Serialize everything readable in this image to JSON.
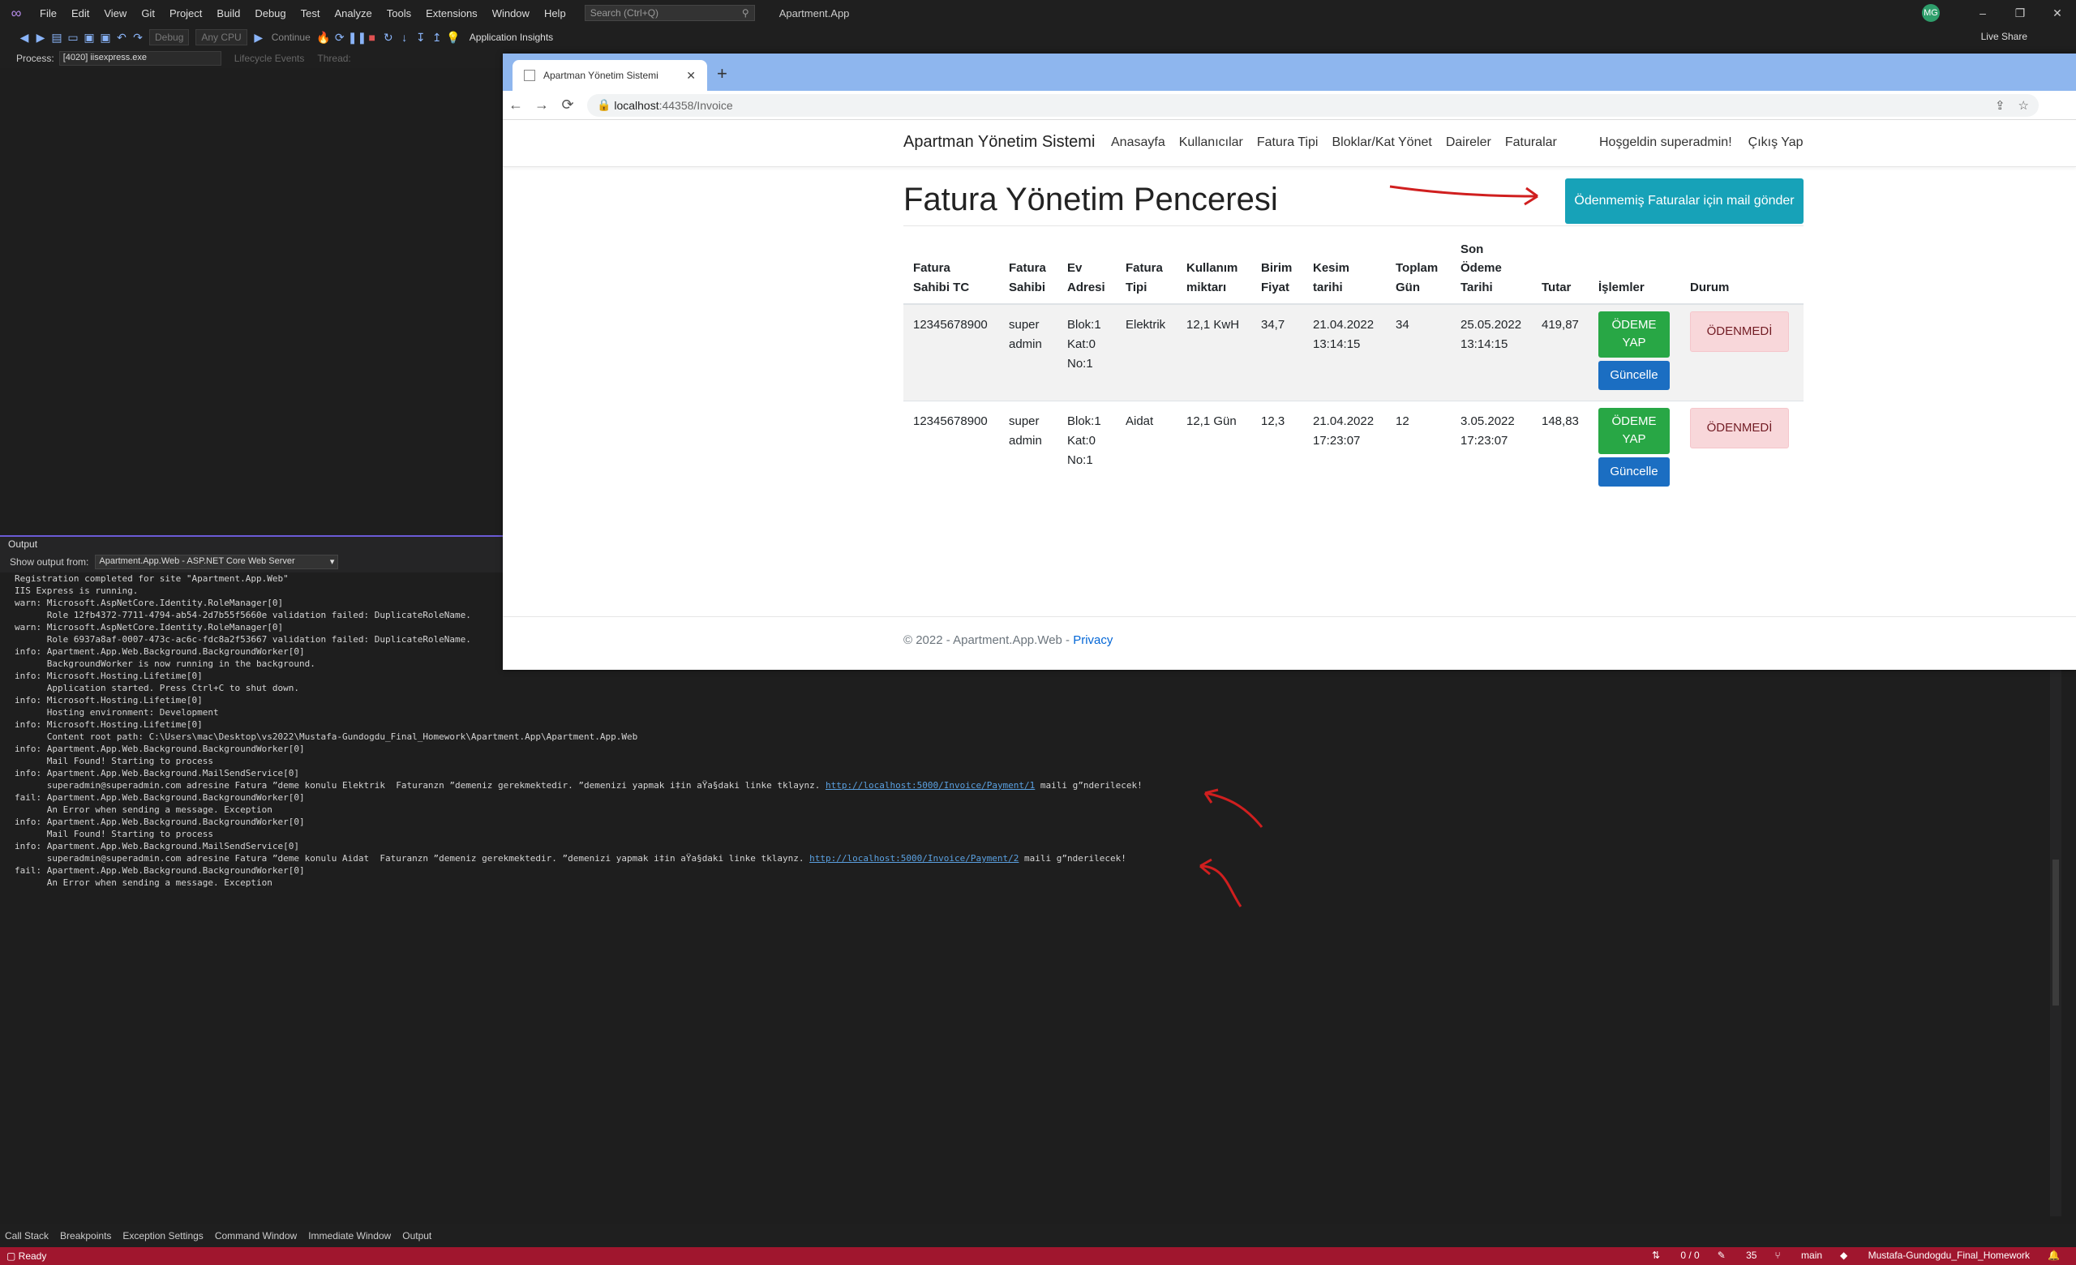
{
  "vs": {
    "menu": [
      "File",
      "Edit",
      "View",
      "Git",
      "Project",
      "Build",
      "Debug",
      "Test",
      "Analyze",
      "Tools",
      "Extensions",
      "Window",
      "Help"
    ],
    "search_placeholder": "Search (Ctrl+Q)",
    "solution_title": "Apartment.App",
    "avatar_initials": "MG",
    "toolbar": {
      "config": "Debug",
      "platform": "Any CPU",
      "continue": "Continue",
      "app_insights": "Application Insights",
      "live_share": "Live Share"
    },
    "process": {
      "label": "Process:",
      "value": "[4020] iisexpress.exe",
      "lifecycle": "Lifecycle Events",
      "thread": "Thread:"
    },
    "output": {
      "title": "Output",
      "show_from_label": "Show output from:",
      "show_from_value": "Apartment.App.Web - ASP.NET Core Web Server",
      "lines": [
        "Registration completed for site \"Apartment.App.Web\"",
        "IIS Express is running.",
        "warn: Microsoft.AspNetCore.Identity.RoleManager[0]",
        "      Role 12fb4372-7711-4794-ab54-2d7b55f5660e validation failed: DuplicateRoleName.",
        "warn: Microsoft.AspNetCore.Identity.RoleManager[0]",
        "      Role 6937a8af-0007-473c-ac6c-fdc8a2f53667 validation failed: DuplicateRoleName.",
        "info: Apartment.App.Web.Background.BackgroundWorker[0]",
        "      BackgroundWorker is now running in the background.",
        "info: Microsoft.Hosting.Lifetime[0]",
        "      Application started. Press Ctrl+C to shut down.",
        "info: Microsoft.Hosting.Lifetime[0]",
        "      Hosting environment: Development",
        "info: Microsoft.Hosting.Lifetime[0]",
        "      Content root path: C:\\Users\\mac\\Desktop\\vs2022\\Mustafa-Gundogdu_Final_Homework\\Apartment.App\\Apartment.App.Web",
        "info: Apartment.App.Web.Background.BackgroundWorker[0]",
        "      Mail Found! Starting to process",
        "info: Apartment.App.Web.Background.MailSendService[0]",
        "      superadmin@superadmin.com adresine Fatura ”deme konulu Elektrik  Faturanzn ”demeniz gerekmektedir. ”demenizi yapmak i‡in aŸa§daki linke tklaynz. ",
        "fail: Apartment.App.Web.Background.BackgroundWorker[0]",
        "      An Error when sending a message. Exception",
        "info: Apartment.App.Web.Background.BackgroundWorker[0]",
        "      Mail Found! Starting to process",
        "info: Apartment.App.Web.Background.MailSendService[0]",
        "      superadmin@superadmin.com adresine Fatura ”deme konulu Aidat  Faturanzn ”demeniz gerekmektedir. ”demenizi yapmak i‡in aŸa§daki linke tklaynz. ",
        "fail: Apartment.App.Web.Background.BackgroundWorker[0]",
        "      An Error when sending a message. Exception"
      ],
      "link1": "http://localhost:5000/Invoice/Payment/1",
      "link1_suffix": " maili g”nderilecek!",
      "link2": "http://localhost:5000/Invoice/Payment/2",
      "link2_suffix": " maili g”nderilecek!"
    },
    "bottom_tabs": [
      "Call Stack",
      "Breakpoints",
      "Exception Settings",
      "Command Window",
      "Immediate Window",
      "Output"
    ],
    "status": {
      "ready": "Ready",
      "errors": "0 / 0",
      "edits": "35",
      "branch": "main",
      "repo": "Mustafa-Gundogdu_Final_Homework"
    }
  },
  "browser": {
    "tab_title": "Apartman Yönetim Sistemi",
    "url_host": "localhost",
    "url_path": ":44358/Invoice",
    "site": {
      "brand": "Apartman Yönetim Sistemi",
      "nav": [
        "Anasayfa",
        "Kullanıcılar",
        "Fatura Tipi",
        "Bloklar/Kat Yönet",
        "Daireler",
        "Faturalar"
      ],
      "greeting": "Hoşgeldin superadmin!",
      "logout": "Çıkış Yap",
      "page_title": "Fatura Yönetim Penceresi",
      "mail_button": "Ödenmemiş Faturalar için mail gönder",
      "table": {
        "headers": [
          "Fatura Sahibi TC",
          "Fatura Sahibi",
          "Ev Adresi",
          "Fatura Tipi",
          "Kullanım miktarı",
          "Birim Fiyat",
          "Kesim tarihi",
          "Toplam Gün",
          "Son Ödeme Tarihi",
          "Tutar",
          "İşlemler",
          "Durum"
        ],
        "rows": [
          {
            "tc": "12345678900",
            "owner": "super admin",
            "address": "Blok:1 Kat:0 No:1",
            "type": "Elektrik",
            "usage": "12,1 KwH",
            "unit_price": "34,7",
            "issue_date": "21.04.2022 13:14:15",
            "days": "34",
            "due_date": "25.05.2022 13:14:15",
            "amount": "419,87",
            "pay": "ÖDEME YAP",
            "update": "Güncelle",
            "status": "ÖDENMEDİ"
          },
          {
            "tc": "12345678900",
            "owner": "super admin",
            "address": "Blok:1 Kat:0 No:1",
            "type": "Aidat",
            "usage": "12,1 Gün",
            "unit_price": "12,3",
            "issue_date": "21.04.2022 17:23:07",
            "days": "12",
            "due_date": "3.05.2022 17:23:07",
            "amount": "148,83",
            "pay": "ÖDEME YAP",
            "update": "Güncelle",
            "status": "ÖDENMEDİ"
          }
        ]
      },
      "footer": "© 2022 - Apartment.App.Web - ",
      "footer_link": "Privacy"
    }
  }
}
